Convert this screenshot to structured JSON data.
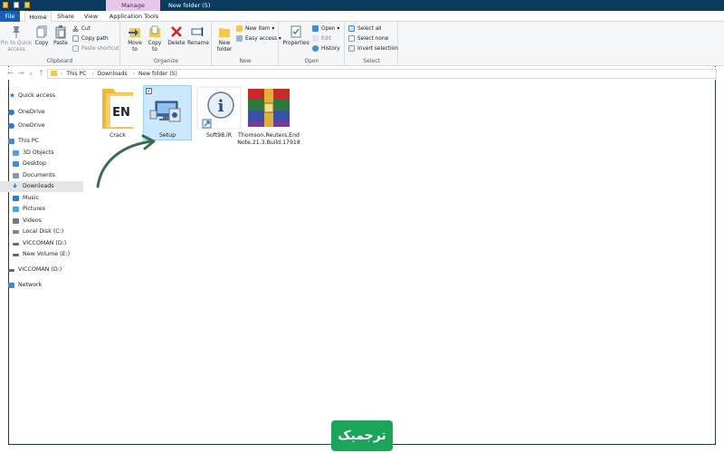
{
  "titlebar": {
    "manage_label": "Manage",
    "window_title": "New folder (5)"
  },
  "tabs": [
    {
      "label": "File"
    },
    {
      "label": "Home"
    },
    {
      "label": "Share"
    },
    {
      "label": "View"
    },
    {
      "label": "Application Tools"
    }
  ],
  "ribbon": {
    "clipboard": {
      "pin_label": "Pin to Quick",
      "pin_label2": "access",
      "copy_label": "Copy",
      "paste_label": "Paste",
      "cut_label": "Cut",
      "copy_path_label": "Copy path",
      "paste_shortcut_label": "Paste shortcut",
      "group_label": "Clipboard"
    },
    "organize": {
      "move_label": "Move",
      "move_label2": "to",
      "copy_label": "Copy",
      "copy_label2": "to",
      "delete_label": "Delete",
      "rename_label": "Rename",
      "group_label": "Organize"
    },
    "new": {
      "new_folder_label": "New",
      "new_folder_label2": "folder",
      "new_item_label": "New item",
      "easy_access_label": "Easy access",
      "group_label": "New"
    },
    "open": {
      "properties_label": "Properties",
      "open_label": "Open",
      "edit_label": "Edit",
      "history_label": "History",
      "group_label": "Open"
    },
    "select": {
      "select_all_label": "Select all",
      "select_none_label": "Select none",
      "invert_label": "Invert selection",
      "group_label": "Select"
    }
  },
  "address": {
    "crumbs": [
      "This PC",
      "Downloads",
      "New folder (5)"
    ]
  },
  "nav": [
    {
      "label": "Quick access",
      "icon": "star-icon",
      "color": "#1a73e8"
    },
    {
      "label": "OneDrive",
      "icon": "cloud-icon",
      "color": "#2b7cd3"
    },
    {
      "label": "OneDrive",
      "icon": "cloud-icon",
      "color": "#2b7cd3"
    },
    {
      "label": "This PC",
      "icon": "computer-icon",
      "color": "#3c8dde"
    },
    {
      "label": "3D Objects",
      "icon": "cube-icon",
      "color": "#4fa3e0"
    },
    {
      "label": "Desktop",
      "icon": "desktop-icon",
      "color": "#3c8dde"
    },
    {
      "label": "Documents",
      "icon": "document-icon",
      "color": "#6b7c8c"
    },
    {
      "label": "Downloads",
      "icon": "download-icon",
      "color": "#1a73e8"
    },
    {
      "label": "Music",
      "icon": "music-icon",
      "color": "#2b7cd3"
    },
    {
      "label": "Pictures",
      "icon": "pictures-icon",
      "color": "#4fa3e0"
    },
    {
      "label": "Videos",
      "icon": "videos-icon",
      "color": "#6b7c8c"
    },
    {
      "label": "Local Disk (C:)",
      "icon": "drive-icon",
      "color": "#5a6b7a"
    },
    {
      "label": "VICCOMAN (D:)",
      "icon": "drive-icon",
      "color": "#5a6b7a"
    },
    {
      "label": "New Volume (E:)",
      "icon": "drive-icon",
      "color": "#5a6b7a"
    },
    {
      "label": "VICCOMAN (D:)",
      "icon": "drive-icon",
      "color": "#5a6b7a"
    },
    {
      "label": "Network",
      "icon": "network-icon",
      "color": "#3c8dde"
    }
  ],
  "files": [
    {
      "label": "Crack",
      "icon": "endnote-folder-icon"
    },
    {
      "label": "Setup",
      "icon": "setup-icon"
    },
    {
      "label": "Soft98.iR",
      "icon": "info-shortcut-icon"
    },
    {
      "label": "Thomson.Reuters.EndNote.21.3.Build.17918",
      "icon": "winrar-archive-icon"
    }
  ],
  "watermark": {
    "text": "ترجمیک"
  }
}
